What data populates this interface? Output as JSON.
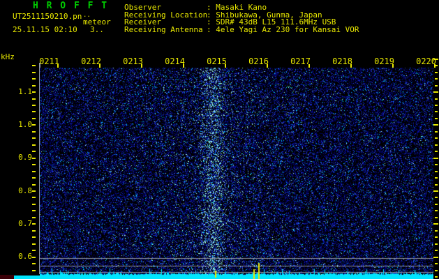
{
  "header": {
    "app_title": "H R O F F T",
    "filename": "UT2511150210.pn",
    "overlay_artifact": "..",
    "overlay_label": "meteor",
    "timestamp": "25.11.15 02:10",
    "sample_count": "3..",
    "colon_sep": ": ",
    "info": [
      {
        "label": "Observer",
        "value": "Masaki Kano"
      },
      {
        "label": "Receiving Location",
        "value": "Shibukawa, Gunma, Japan"
      },
      {
        "label": "Receiver",
        "value": "SDR# 43dB L15 111.6MHz USB"
      },
      {
        "label": "Receiving Antenna",
        "value": "4ele Yagi Az 230 for Kansai VOR"
      }
    ]
  },
  "axes": {
    "freq_unit": "kHz",
    "freq_labels": [
      "1.1",
      "1.0",
      "0.9",
      "0.8",
      "0.7",
      "0.6"
    ],
    "time_labels": [
      "0211",
      "0212",
      "0213",
      "0214",
      "0215",
      "0216",
      "0217",
      "0218",
      "0219",
      "0220"
    ]
  },
  "spectrogram": {
    "type": "spectrogram",
    "x_axis": "time (UT, 0210-0220)",
    "y_axis": "audio frequency kHz (0.6-1.1 labeled)",
    "noise_style": "blue speckle on black",
    "enhanced_vertical_band_near": "0215",
    "meter_strip": "cyan signal-strength strip along bottom",
    "event_marker_count": 3
  },
  "colors": {
    "title_green": "#00cc00",
    "text_yellow": "#e8e800",
    "meter_cyan": "#00e6ff",
    "grid_gray": "#8f94a2",
    "axis_line": "#9097a5",
    "red_strip": "#3a0008",
    "background": "#000000"
  }
}
